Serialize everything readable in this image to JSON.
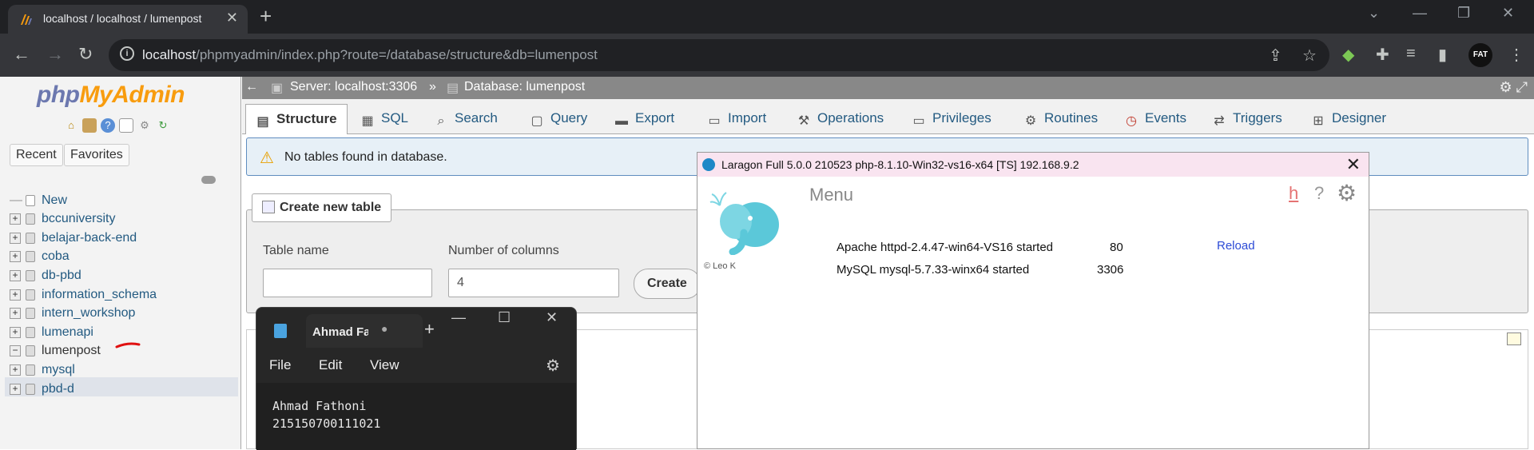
{
  "browser": {
    "tab_title": "localhost / localhost / lumenpost",
    "tab_close": "✕",
    "new_tab": "+",
    "url_host": "localhost",
    "url_path": "/phpmyadmin/index.php?route=/database/structure&db=lumenpost",
    "profile_label": "FAT",
    "window_controls": [
      "⌄",
      "—",
      "❐",
      "✕"
    ],
    "toolbar_icons": [
      "share-icon",
      "star-icon",
      "extension-color-icon",
      "puzzle-icon",
      "media-icon",
      "sidepanel-icon"
    ]
  },
  "pma": {
    "logo_php": "php",
    "logo_myadmin": "MyAdmin",
    "recent": "Recent",
    "favorites": "Favorites",
    "tree": [
      {
        "label": "New"
      },
      {
        "label": "bccuniversity"
      },
      {
        "label": "belajar-back-end"
      },
      {
        "label": "coba"
      },
      {
        "label": "db-pbd"
      },
      {
        "label": "information_schema"
      },
      {
        "label": "intern_workshop"
      },
      {
        "label": "lumenapi"
      },
      {
        "label": "lumenpost"
      },
      {
        "label": "mysql"
      },
      {
        "label": "pbd-d"
      }
    ],
    "breadcrumb": {
      "server": "Server: localhost:3306",
      "separator": "»",
      "database": "Database: lumenpost"
    },
    "tabs": [
      "Structure",
      "SQL",
      "Search",
      "Query",
      "Export",
      "Import",
      "Operations",
      "Privileges",
      "Routines",
      "Events",
      "Triggers",
      "Designer"
    ],
    "notice": "No tables found in database.",
    "create_table": {
      "legend": "Create new table",
      "table_name_label": "Table name",
      "table_name_value": "",
      "columns_label": "Number of columns",
      "columns_value": "4",
      "create_button": "Create"
    }
  },
  "notepad": {
    "tab_title": "Ahmad Fathoni",
    "modified_dot": "●",
    "new_tab": "+",
    "controls": [
      "—",
      "☐",
      "✕"
    ],
    "menu": [
      "File",
      "Edit",
      "View"
    ],
    "lines": [
      "Ahmad Fathoni",
      "215150700111021"
    ]
  },
  "laragon": {
    "title": "Laragon Full 5.0.0 210523 php-8.1.10-Win32-vs16-x64 [TS]  192.168.9.2",
    "close": "✕",
    "menu": "Menu",
    "help_h": "h",
    "help_q": "?",
    "credit": "© Leo K",
    "services": [
      {
        "name": "Apache httpd-2.4.47-win64-VS16 started",
        "port": "80"
      },
      {
        "name": "MySQL mysql-5.7.33-winx64 started",
        "port": "3306"
      }
    ],
    "reload": "Reload",
    "colors": {
      "title_bg": "#f9e4f0",
      "elephant": "#5bc8d9",
      "reload": "#2d4bd6"
    }
  }
}
